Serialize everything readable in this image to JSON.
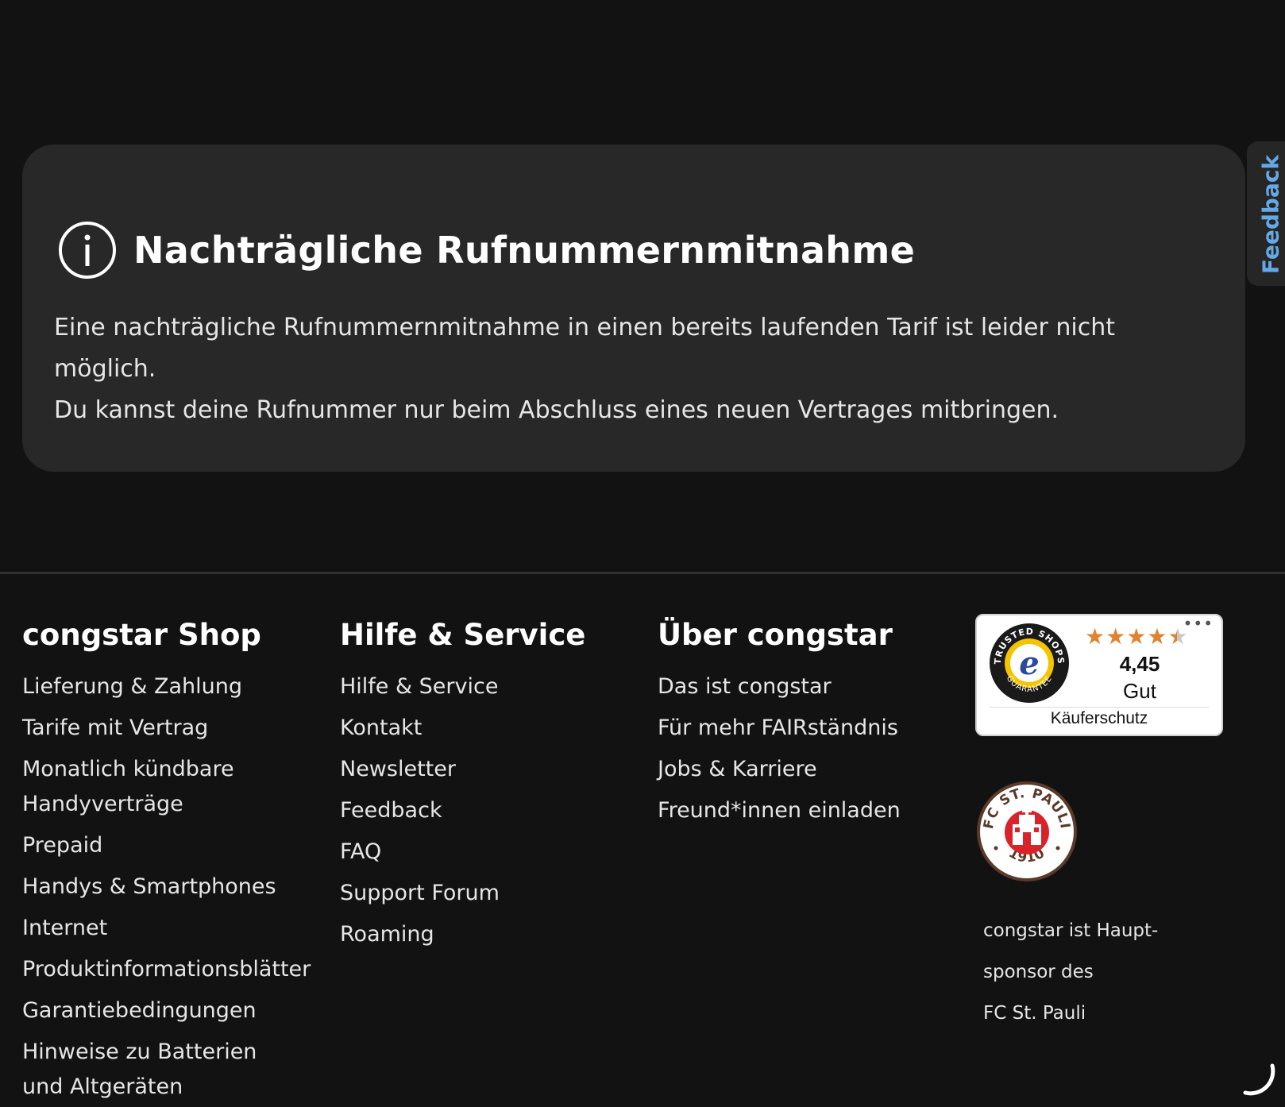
{
  "info": {
    "title": "Nachträgliche Rufnummernmitnahme",
    "body_line1": "Eine nachträgliche Rufnummernmitnahme in einen bereits laufenden Tarif ist leider nicht möglich.",
    "body_line2": "Du kannst deine Rufnummer nur beim Abschluss eines neuen Vertrages mitbringen.",
    "icon": "info-circle-icon"
  },
  "feedback_tab": {
    "label": "Feedback"
  },
  "footer": {
    "shop": {
      "heading": "congstar Shop",
      "links": [
        "Lieferung & Zahlung",
        "Tarife mit Vertrag",
        "Monatlich kündbare Handyverträge",
        "Prepaid",
        "Handys & Smartphones",
        "Internet",
        "Produktinformationsblätter",
        "Garantiebedingungen",
        "Hinweise zu Batterien und Altgeräten"
      ]
    },
    "help": {
      "heading": "Hilfe & Service",
      "links": [
        "Hilfe & Service",
        "Kontakt",
        "Newsletter",
        "Feedback",
        "FAQ",
        "Support Forum",
        "Roaming"
      ]
    },
    "about": {
      "heading": "Über congstar",
      "links": [
        "Das ist congstar",
        "Für mehr FAIRständnis",
        "Jobs & Karriere",
        "Freund*innen einladen"
      ]
    }
  },
  "trusted_shops": {
    "seal_top_text": "TRUSTED SHOPS",
    "seal_bottom_text": "GUARANTEE",
    "seal_letter": "e",
    "rating": 4.45,
    "rating_max": 5,
    "score_label": "4,45",
    "grade": "Gut",
    "caption": "Käuferschutz",
    "more_label": "•••",
    "star_color": "#e0822e"
  },
  "sponsor": {
    "logo_top_text": "FC ST. PAULI",
    "logo_year": "1910",
    "line1": "congstar ist Haupt-",
    "line2": "sponsor des",
    "line3": "FC St. Pauli"
  }
}
